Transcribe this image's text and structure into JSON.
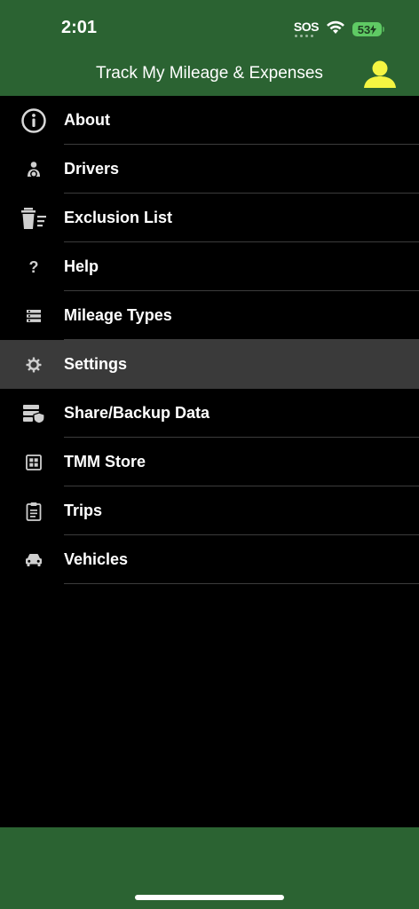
{
  "status_bar": {
    "time": "2:01",
    "sos": "SOS",
    "battery": "53"
  },
  "header": {
    "title": "Track My Mileage & Expenses",
    "profile_icon_color": "#f5f542"
  },
  "menu": {
    "items": [
      {
        "label": "About",
        "icon": "info-icon"
      },
      {
        "label": "Drivers",
        "icon": "driver-icon"
      },
      {
        "label": "Exclusion List",
        "icon": "trash-list-icon"
      },
      {
        "label": "Help",
        "icon": "question-icon"
      },
      {
        "label": "Mileage Types",
        "icon": "list-icon"
      },
      {
        "label": "Settings",
        "icon": "gear-icon",
        "selected": true
      },
      {
        "label": "Share/Backup Data",
        "icon": "backup-icon"
      },
      {
        "label": "TMM Store",
        "icon": "store-icon"
      },
      {
        "label": "Trips",
        "icon": "clipboard-icon"
      },
      {
        "label": "Vehicles",
        "icon": "car-icon"
      }
    ]
  },
  "colors": {
    "bar_green": "#2b6332",
    "selected_row": "#3a3a3a"
  }
}
